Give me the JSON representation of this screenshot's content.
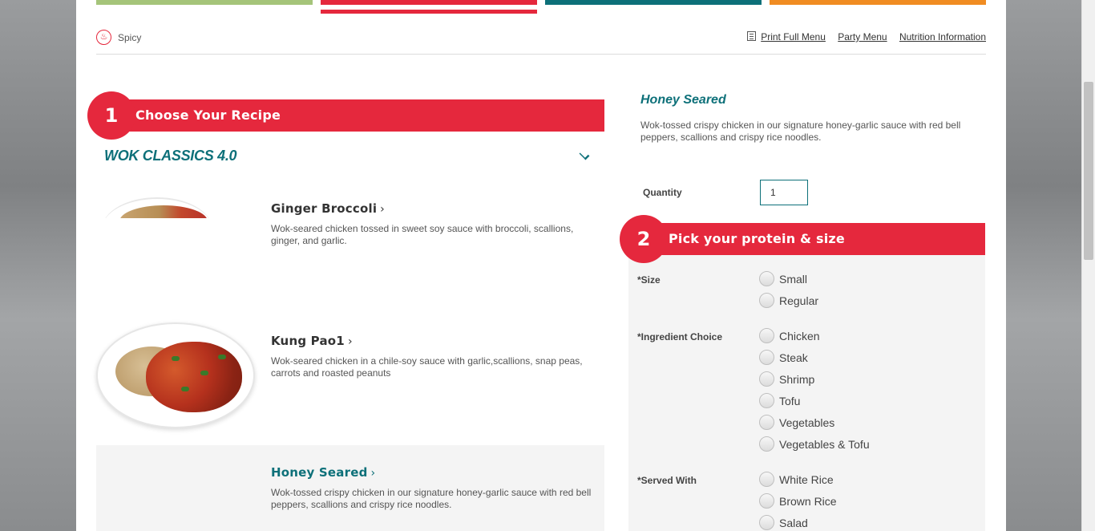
{
  "utility": {
    "spicy_label": "Spicy",
    "print_label": "Print Full Menu",
    "party_label": "Party Menu",
    "nutrition_label": "Nutrition Information"
  },
  "step1": {
    "number": "1",
    "title": "Choose Your Recipe"
  },
  "category": "WOK CLASSICS 4.0",
  "recipes": [
    {
      "name": "Ginger Broccoli",
      "arrow": "›",
      "desc": "Wok-seared chicken tossed in sweet soy sauce with broccoli, scallions, ginger, and garlic."
    },
    {
      "name": "Kung Pao1",
      "arrow": "›",
      "desc": "Wok-seared chicken in a chile-soy sauce with garlic,scallions, snap peas, carrots and roasted peanuts"
    },
    {
      "name": "Honey Seared",
      "arrow": "›",
      "desc": "Wok-tossed crispy chicken in our signature honey-garlic sauce with red bell peppers, scallions and crispy rice noodles."
    }
  ],
  "detail": {
    "title": "Honey Seared",
    "desc": "Wok-tossed crispy chicken in our signature honey-garlic sauce with red bell peppers, scallions and crispy rice noodles.",
    "quantity_label": "Quantity",
    "quantity_value": "1"
  },
  "step2": {
    "number": "2",
    "title": "Pick your protein & size"
  },
  "options": {
    "size_label": "*Size",
    "size": [
      "Small",
      "Regular"
    ],
    "ingredient_label": "*Ingredient Choice",
    "ingredient": [
      "Chicken",
      "Steak",
      "Shrimp",
      "Tofu",
      "Vegetables",
      "Vegetables & Tofu"
    ],
    "served_label": "*Served With",
    "served": [
      "White Rice",
      "Brown Rice",
      "Salad"
    ]
  },
  "colors": {
    "red": "#e5283d",
    "teal": "#0d7079",
    "green": "#a5c47a",
    "orange": "#f08c22"
  }
}
